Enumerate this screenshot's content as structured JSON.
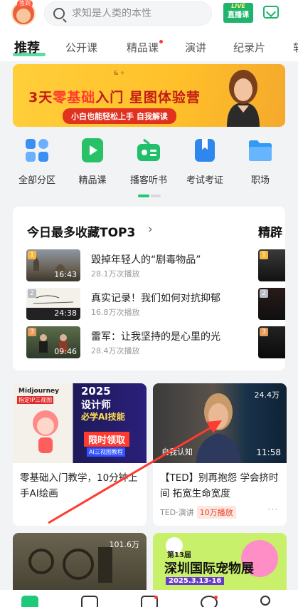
{
  "header": {
    "avatar_badge": "签到",
    "search_placeholder": "求知是人类的本性",
    "live_top": "LIVE",
    "live_label": "直播课"
  },
  "tabs": [
    {
      "label": "推荐",
      "active": true
    },
    {
      "label": "公开课"
    },
    {
      "label": "精品课",
      "has_dot": true
    },
    {
      "label": "演讲"
    },
    {
      "label": "纪录片"
    },
    {
      "label": "软"
    }
  ],
  "banner": {
    "logo_text": "& ✧",
    "headline_a": "3天",
    "headline_b": "零基础",
    "headline_c": "入门  星图体验营",
    "pill": "小白也能轻松上手  自我解读"
  },
  "grid": [
    {
      "label": "全部分区",
      "icon": "grid-icon",
      "color": "#3a8ff5"
    },
    {
      "label": "精品课",
      "icon": "play-icon",
      "color": "#27c268"
    },
    {
      "label": "播客听书",
      "icon": "radio-icon",
      "color": "#20c06b"
    },
    {
      "label": "考试考证",
      "icon": "bookmark-icon",
      "color": "#2f86ef"
    },
    {
      "label": "职场",
      "icon": "folder-icon",
      "color": "#3399f3"
    }
  ],
  "top3": {
    "title": "今日最多收藏TOP3",
    "side_title": "精辟",
    "items": [
      {
        "rank": "1",
        "duration": "16:43",
        "title": "毁掉年轻人的“剧毒物品”",
        "stats": "28.1万次播放",
        "rank_color": "#f6b73c"
      },
      {
        "rank": "2",
        "duration": "24:38",
        "title": "真实记录！我们如何对抗抑郁",
        "stats": "16.8万次播放",
        "rank_color": "#b8bcc4"
      },
      {
        "rank": "3",
        "duration": "09:46",
        "title": "雷军：让我坚持的是心里的光",
        "stats": "28.4万次播放",
        "rank_color": "#e69a5c"
      }
    ],
    "side_ranks": [
      "1",
      "2",
      "3"
    ]
  },
  "cards": [
    {
      "thumb_lines": [
        "Midjourney",
        "指定IP三视图",
        "2025",
        "设计师",
        "必学AI技能",
        "限时领取",
        "AI三视图教程"
      ],
      "title": "零基础入门教学，10分钟上手AI绘画",
      "meta": "",
      "tag": ""
    },
    {
      "views": "24.4万",
      "corner_text": "自我认知",
      "duration": "11:58",
      "title": "【TED】别再抱怨 学会挤时间 拓宽生命宽度",
      "meta": "TED·演讲",
      "tag": "10万播放"
    },
    {
      "views": "101.6万",
      "title": "",
      "meta": "",
      "tag": ""
    },
    {
      "thumb_lines": [
        "第13届",
        "深圳国际宠物展",
        "2025.3.13-16"
      ],
      "title": "",
      "meta": "",
      "tag": ""
    }
  ],
  "more_glyph": "···",
  "arrow_glyph": "›"
}
